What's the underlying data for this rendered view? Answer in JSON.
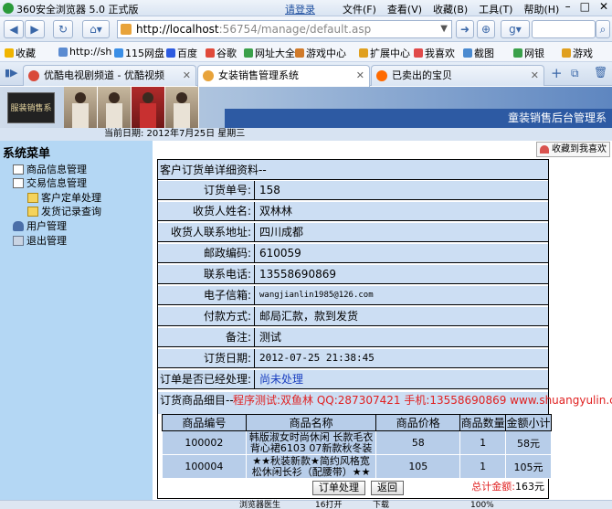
{
  "browser": {
    "title": "360安全浏览器 5.0 正式版",
    "login": "请登录",
    "menus": [
      "文件(F)",
      "查看(V)",
      "收藏(B)",
      "工具(T)",
      "帮助(H)"
    ],
    "address_host": "http://localhost",
    "address_path": ":56754/manage/default.asp",
    "bookmarks": [
      "收藏",
      "http://sh",
      "115网盘",
      "百度",
      "谷歌",
      "网址大全",
      "游戏中心",
      "扩展中心",
      "我喜欢",
      "截图",
      "网银",
      "游戏"
    ],
    "tabs": [
      "优酷电视剧频道 - 优酷视频",
      "女装销售管理系统",
      "已卖出的宝贝"
    ],
    "status_left": "浏览器医生",
    "status_mid": "16打开",
    "status_download": "下载",
    "status_zoom": "100%"
  },
  "banner": {
    "logo_text": "服装销售系统",
    "title": "童装销售后台管理系"
  },
  "date_line": "当前日期: 2012年7月25日  星期三",
  "sidebar": {
    "heading": "系统菜单",
    "items": [
      "商品信息管理",
      "交易信息管理",
      "客户定单处理",
      "发货记录查询",
      "用户管理",
      "退出管理"
    ]
  },
  "fav_button": "收藏到我喜欢",
  "order": {
    "panel_title": "客户订货单详细资料--",
    "fields": [
      {
        "label": "订货单号:",
        "value": "158"
      },
      {
        "label": "收货人姓名:",
        "value": "双林林"
      },
      {
        "label": "收货人联系地址:",
        "value": "四川成都"
      },
      {
        "label": "邮政编码:",
        "value": "610059"
      },
      {
        "label": "联系电话:",
        "value": "13558690869"
      },
      {
        "label": "电子信箱:",
        "value": "wangjianlin1985@126.com"
      },
      {
        "label": "付款方式:",
        "value": "邮局汇款，款到发货"
      },
      {
        "label": "备注:",
        "value": "测试"
      },
      {
        "label": "订货日期:",
        "value": "2012-07-25 21:38:45"
      },
      {
        "label": "订单是否已经处理:",
        "value": "尚未处理"
      }
    ],
    "items_heading": "订货商品细目--",
    "promo": "程序测试:双鱼林 QQ:287307421 手机:13558690869 www.shuangyulin.com",
    "columns": [
      "商品编号",
      "商品名称",
      "商品价格",
      "商品数量",
      "金额小计"
    ],
    "rows": [
      {
        "id": "100002",
        "name1": "韩版淑女时尚休闲 长款毛衣",
        "name2": "背心裙6103 07新款秋冬装",
        "price": "58",
        "qty": "1",
        "subtotal": "58元"
      },
      {
        "id": "100004",
        "name1": "★★秋装新款★简约风格宽",
        "name2": "松休闲长衫（配腰带）★★",
        "price": "105",
        "qty": "1",
        "subtotal": "105元"
      }
    ],
    "total_label": "总计金额:",
    "total_value": "163元",
    "btn_process": "订单处理",
    "btn_back": "返回"
  }
}
